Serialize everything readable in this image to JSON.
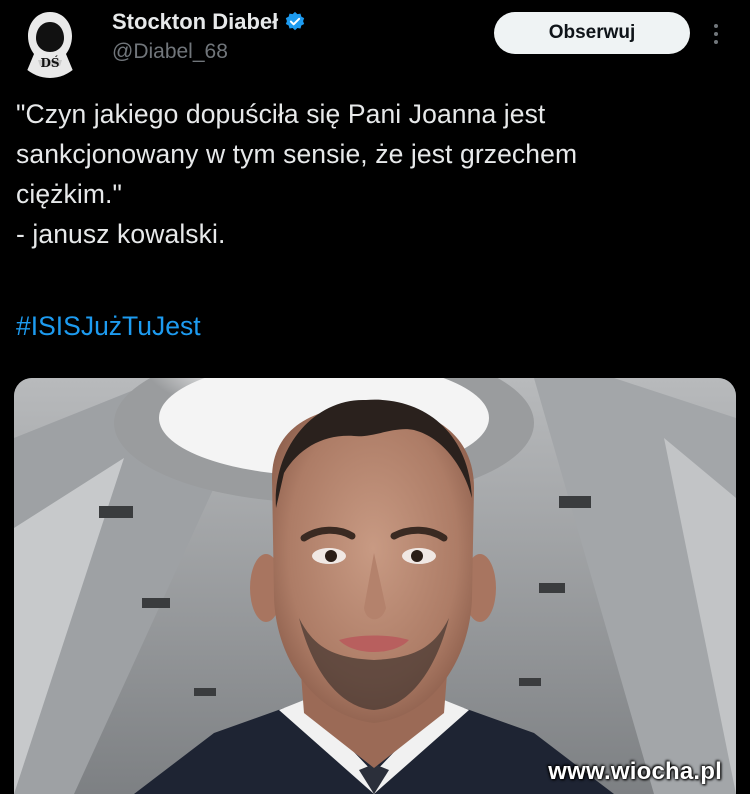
{
  "author": {
    "display_name": "Stockton Diabeł",
    "handle": "@Diabel_68",
    "avatar_letters": "DŚ"
  },
  "follow_label": "Obserwuj",
  "tweet": {
    "lines": [
      "\"Czyn jakiego dopuściła się Pani Joanna jest",
      "sankcjonowany w tym sensie, że jest grzechem",
      "ciężkim.\"",
      "- janusz kowalski."
    ],
    "hashtag": "#ISISJużTuJest"
  },
  "watermark": "www.wiocha.pl",
  "colors": {
    "background": "#000000",
    "text": "#e7e9ea",
    "secondary": "#71767b",
    "link": "#1d9bf0",
    "verified": "#1d9bf0",
    "follow_bg": "#eff3f4"
  },
  "icons": [
    "avatar-hooded-figure",
    "verified-badge-icon",
    "more-options-icon"
  ]
}
